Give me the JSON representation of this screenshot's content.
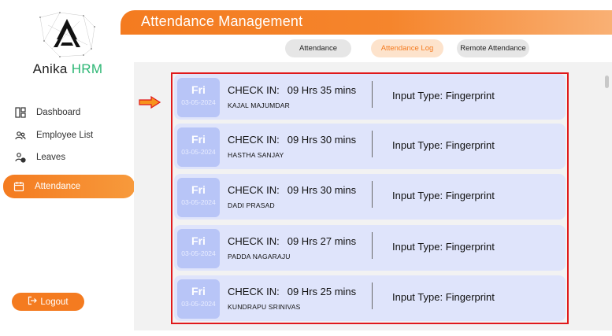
{
  "brand": {
    "name": "Anika",
    "suffix": "HRM"
  },
  "nav": [
    {
      "label": "Dashboard",
      "icon": "dashboard-icon"
    },
    {
      "label": "Employee List",
      "icon": "people-icon"
    },
    {
      "label": "Leaves",
      "icon": "leave-icon"
    },
    {
      "label": "Attendance",
      "icon": "calendar-icon",
      "active": true
    }
  ],
  "logout_label": "Logout",
  "header": {
    "title": "Attendance Management"
  },
  "tabs": [
    {
      "label": "Attendance"
    },
    {
      "label": "Attendance Log",
      "active": true
    },
    {
      "label": "Remote Attendance"
    }
  ],
  "records": [
    {
      "day": "Fri",
      "date": "03-05-2024",
      "checkin_label": "CHECK IN:",
      "hours": "09 Hrs 35 mins",
      "name": "KAJAL MAJUMDAR",
      "input_type": "Input Type: Fingerprint"
    },
    {
      "day": "Fri",
      "date": "03-05-2024",
      "checkin_label": "CHECK IN:",
      "hours": "09 Hrs 30 mins",
      "name": "HASTHA SANJAY",
      "input_type": "Input Type: Fingerprint"
    },
    {
      "day": "Fri",
      "date": "03-05-2024",
      "checkin_label": "CHECK IN:",
      "hours": "09 Hrs 30 mins",
      "name": "DADI PRASAD",
      "input_type": "Input Type: Fingerprint"
    },
    {
      "day": "Fri",
      "date": "03-05-2024",
      "checkin_label": "CHECK IN:",
      "hours": "09 Hrs 27 mins",
      "name": "PADDA NAGARAJU",
      "input_type": "Input Type: Fingerprint"
    },
    {
      "day": "Fri",
      "date": "03-05-2024",
      "checkin_label": "CHECK IN:",
      "hours": "09 Hrs 25 mins",
      "name": "KUNDRAPU SRINIVAS",
      "input_type": "Input Type: Fingerprint"
    }
  ],
  "colors": {
    "accent": "#f47b20",
    "brand_green": "#2bb673",
    "card": "#dfe4fb",
    "day_box": "#b8c5f7",
    "highlight": "#e0191b"
  }
}
